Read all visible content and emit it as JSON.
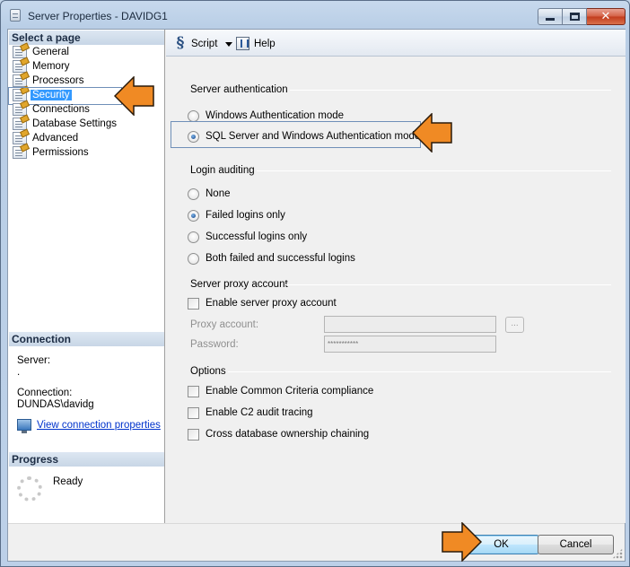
{
  "window": {
    "title": "Server Properties - DAVIDG1",
    "controls": {
      "minimize": "minimize",
      "maximize": "maximize",
      "close": "close"
    }
  },
  "left_pane": {
    "select_header": "Select a page",
    "pages": [
      {
        "label": "General",
        "selected": false
      },
      {
        "label": "Memory",
        "selected": false
      },
      {
        "label": "Processors",
        "selected": false
      },
      {
        "label": "Security",
        "selected": true
      },
      {
        "label": "Connections",
        "selected": false
      },
      {
        "label": "Database Settings",
        "selected": false
      },
      {
        "label": "Advanced",
        "selected": false
      },
      {
        "label": "Permissions",
        "selected": false
      }
    ],
    "connection": {
      "header": "Connection",
      "server_label": "Server:",
      "server_value": ".",
      "connection_label": "Connection:",
      "connection_value": "DUNDAS\\davidg",
      "view_link": "View connection properties"
    },
    "progress": {
      "header": "Progress",
      "status": "Ready"
    }
  },
  "toolbar": {
    "script_label": "Script",
    "help_label": "Help"
  },
  "server_authentication": {
    "title": "Server authentication",
    "options": [
      {
        "label": "Windows Authentication mode",
        "checked": false
      },
      {
        "label": "SQL Server and Windows Authentication mode",
        "checked": true
      }
    ]
  },
  "login_auditing": {
    "title": "Login auditing",
    "options": [
      {
        "label": "None",
        "checked": false
      },
      {
        "label": "Failed logins only",
        "checked": true
      },
      {
        "label": "Successful logins only",
        "checked": false
      },
      {
        "label": "Both failed and successful logins",
        "checked": false
      }
    ]
  },
  "proxy": {
    "title": "Server proxy account",
    "enable_label": "Enable server proxy account",
    "enabled": false,
    "account_label": "Proxy account:",
    "account_value": "",
    "password_label": "Password:",
    "password_value": "***********",
    "browse_label": "..."
  },
  "options": {
    "title": "Options",
    "items": [
      {
        "label": "Enable Common Criteria compliance",
        "checked": false
      },
      {
        "label": "Enable C2 audit tracing",
        "checked": false
      },
      {
        "label": "Cross database ownership chaining",
        "checked": false
      }
    ]
  },
  "buttons": {
    "ok": "OK",
    "cancel": "Cancel"
  },
  "colors": {
    "callout_arrow": "#f08a24",
    "selection": "#3399ff",
    "link": "#0033cc"
  }
}
